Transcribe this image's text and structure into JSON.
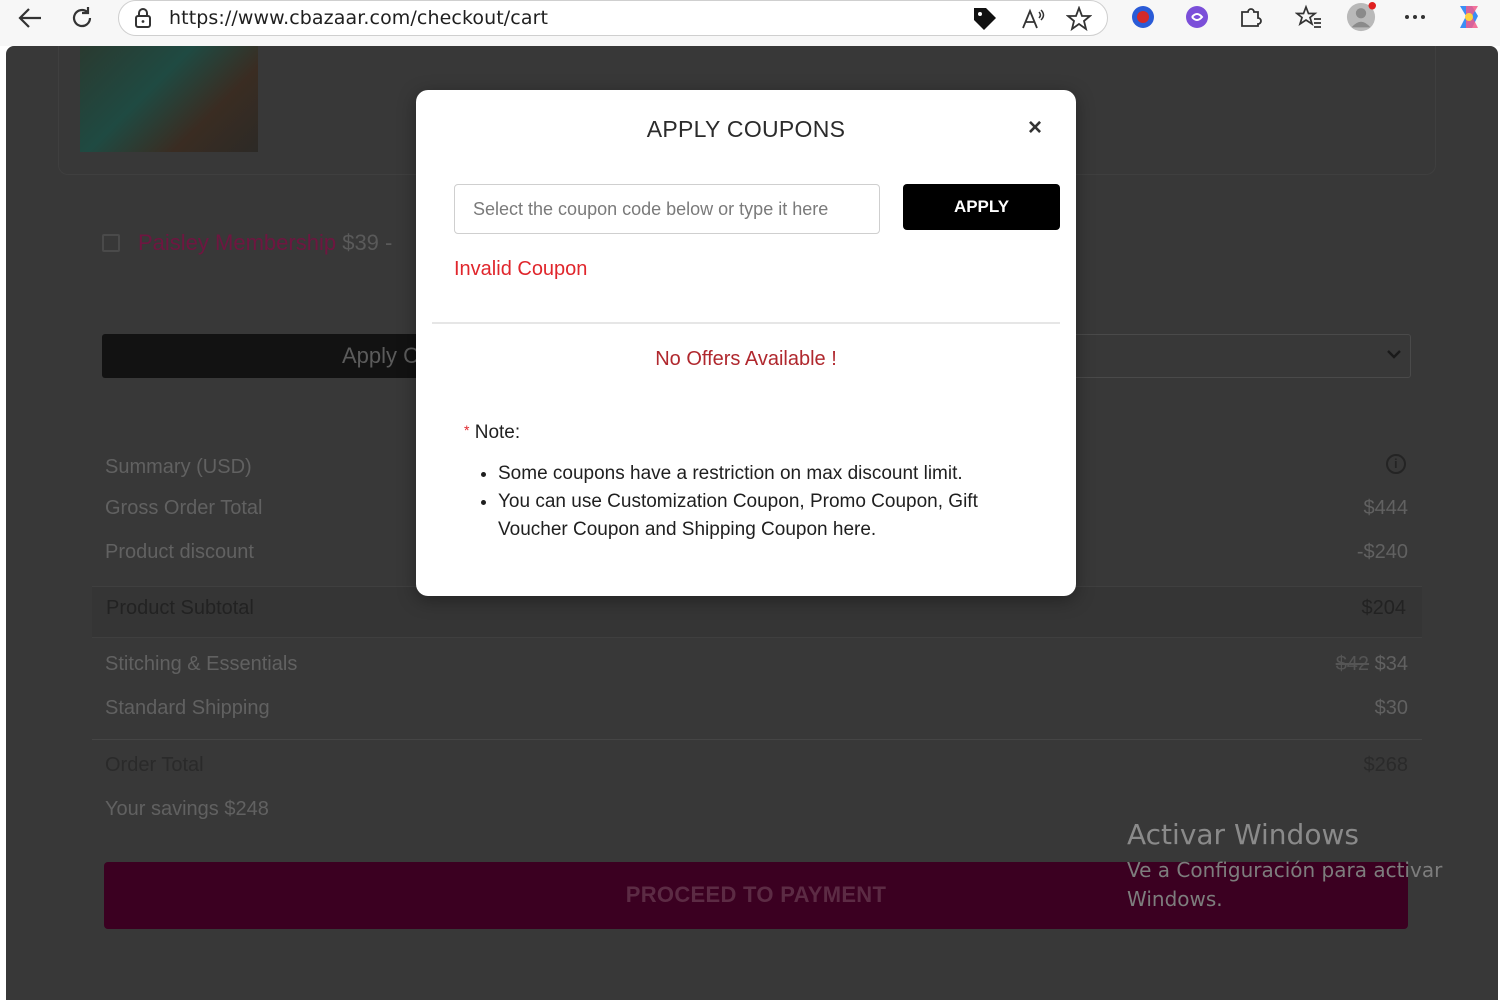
{
  "browser": {
    "url": "https://www.cbazaar.com/checkout/cart"
  },
  "page": {
    "membership": {
      "name": "Paisley Membership",
      "price": "$39 -"
    },
    "apply_coupon_button_partial": "Apply C",
    "summary": {
      "heading": "Summary (USD)",
      "rows": [
        {
          "label": "Gross Order Total",
          "value": "$444"
        },
        {
          "label": "Product discount",
          "value": "-$240"
        },
        {
          "label": "Product Subtotal",
          "value": "$204"
        },
        {
          "label": "Stitching & Essentials",
          "old_value": "$42",
          "value": "$34"
        },
        {
          "label": "Standard Shipping",
          "value": "$30"
        },
        {
          "label": "Order Total",
          "value": "$268"
        }
      ],
      "savings": "Your savings $248"
    },
    "proceed_label": "PROCEED TO PAYMENT"
  },
  "modal": {
    "title": "APPLY COUPONS",
    "close": "×",
    "input_placeholder": "Select the coupon code below or type it here",
    "input_value": "",
    "apply_label": "APPLY",
    "error": "Invalid Coupon",
    "no_offers": "No Offers Available !",
    "note_star": "*",
    "note_title": "Note:",
    "notes": [
      "Some coupons have a restriction on max discount limit.",
      "You can use Customization Coupon, Promo Coupon, Gift Voucher Coupon and Shipping Coupon here."
    ]
  },
  "watermark": {
    "title": "Activar Windows",
    "subtitle": "Ve a Configuración para activar Windows."
  },
  "colors": {
    "overlay_bg": "#383838",
    "brand_maroon": "#3b0021",
    "error_red": "#e0262c",
    "apply_black": "#000000"
  },
  "icons": [
    "back-icon",
    "refresh-icon",
    "lock-icon",
    "tag-icon",
    "read-aloud-icon",
    "favorite-star-icon",
    "extension-shield-icon",
    "extension-purple-icon",
    "extensions-puzzle-icon",
    "favorites-icon",
    "profile-avatar-icon",
    "more-menu-icon",
    "copilot-icon",
    "info-icon",
    "close-icon",
    "chevron-down-icon"
  ]
}
